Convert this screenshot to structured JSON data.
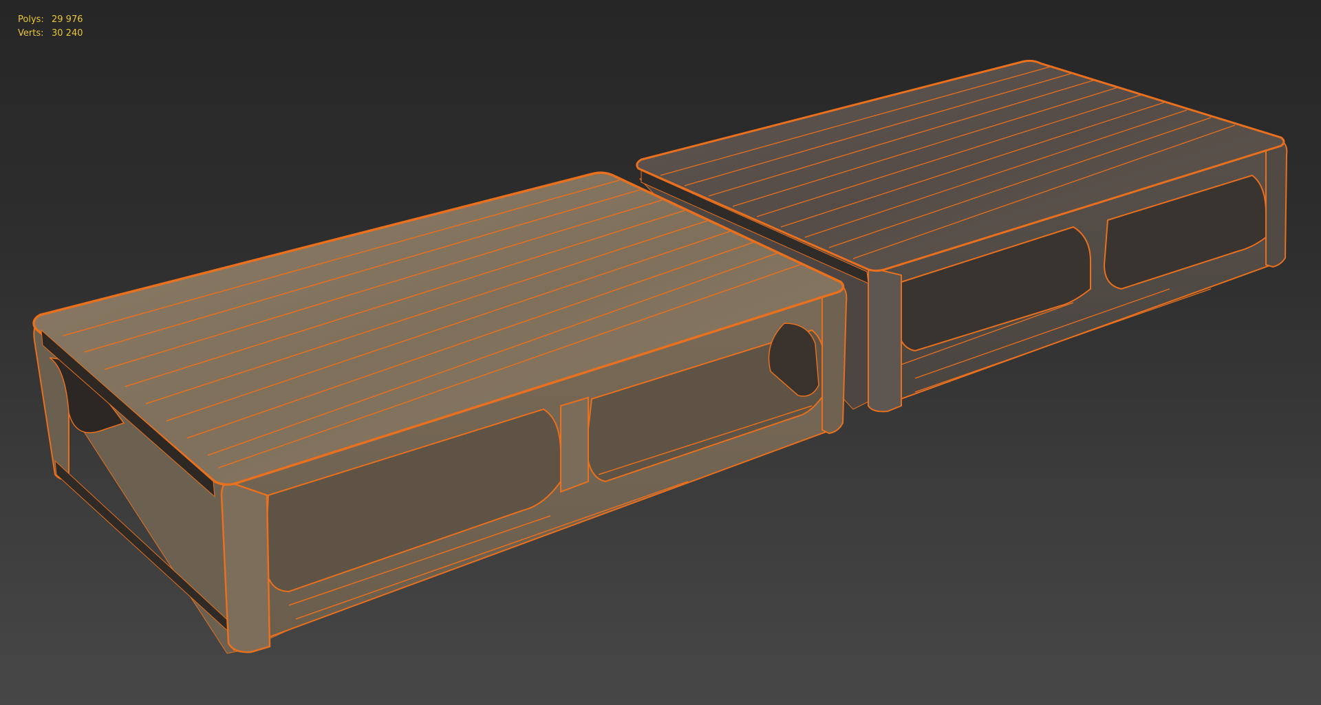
{
  "stats": {
    "polys_label": "Polys:",
    "polys_value": "29 976",
    "verts_label": "Verts:",
    "verts_value": "30 240"
  },
  "colors": {
    "stats_text": "#e8c63a",
    "wire": "#e8701e",
    "wood_light": "#8a7a64",
    "wood_dark": "#5a5048",
    "background_top": "#262626",
    "background_bottom": "#474747"
  },
  "objects": [
    "coffee-table-light",
    "coffee-table-dark"
  ]
}
